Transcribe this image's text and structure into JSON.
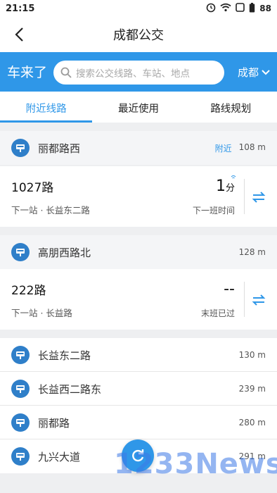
{
  "status_bar": {
    "time": "21:15",
    "battery": "88"
  },
  "nav": {
    "title": "成都公交"
  },
  "search": {
    "brand": "车来了",
    "placeholder": "搜索公交线路、车站、地点",
    "city": "成都"
  },
  "tabs": [
    {
      "label": "附近线路",
      "active": true
    },
    {
      "label": "最近使用",
      "active": false
    },
    {
      "label": "路线规划",
      "active": false
    }
  ],
  "stops": [
    {
      "name": "丽都路西",
      "tag": "附近",
      "distance": "108 m",
      "route": {
        "name": "1027路",
        "next": "下一站 · 长益东二路",
        "time_num": "1",
        "time_unit": "分",
        "time_label": "下一班时间"
      }
    },
    {
      "name": "高朋西路北",
      "distance": "128 m",
      "route": {
        "name": "222路",
        "next": "下一站 · 长益路",
        "time_num": "--",
        "time_label": "末班已过"
      }
    }
  ],
  "nearby_stops": [
    {
      "name": "长益东二路",
      "distance": "130 m"
    },
    {
      "name": "长益西二路东",
      "distance": "239 m"
    },
    {
      "name": "丽都路",
      "distance": "280 m"
    },
    {
      "name": "九兴大道",
      "distance": "291 m"
    }
  ],
  "watermark": "1233News",
  "colors": {
    "accent": "#2f97e8",
    "stop_icon": "#2f7fc9"
  }
}
